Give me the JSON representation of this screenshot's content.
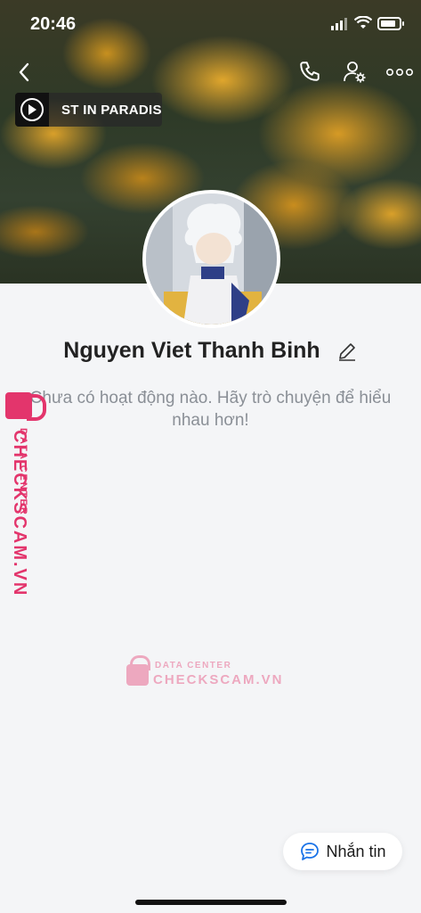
{
  "status": {
    "time": "20:46"
  },
  "colors": {
    "accent": "#1a73e8",
    "watermark": "#e3356c",
    "background": "#f4f5f7"
  },
  "header": {
    "back_icon": "chevron-left-icon",
    "call_icon": "phone-icon",
    "settings_icon": "user-gear-icon",
    "more_icon": "more-dots-icon"
  },
  "music": {
    "title": "ST IN PARADIS"
  },
  "profile": {
    "name": "Nguyen Viet Thanh Binh",
    "activity": "Chưa có hoạt động nào. Hãy trò chuyện để hiểu nhau hơn!"
  },
  "watermark": {
    "label_small": "DATA CENTER",
    "label_big": "CHECKSCAM.VN"
  },
  "actions": {
    "message_label": "Nhắn tin"
  }
}
